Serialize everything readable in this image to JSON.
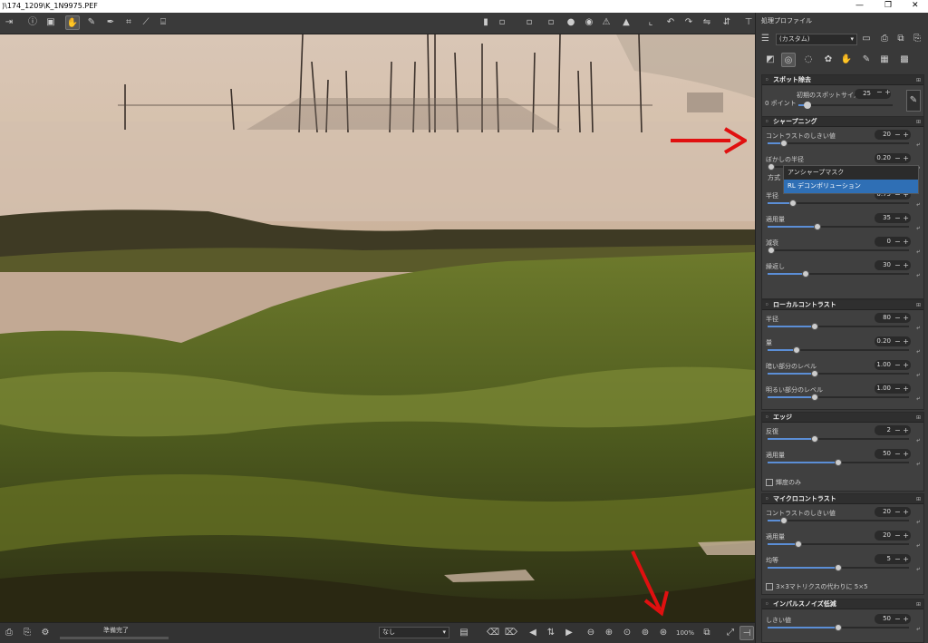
{
  "window": {
    "title": ")\\174_1209\\K_1N9975.PEF",
    "controls": [
      "—",
      "❐",
      "✕"
    ]
  },
  "right_header": {
    "title": "処理プロファイル",
    "profile": "(カスタム)"
  },
  "sections": {
    "spot": {
      "title": "スポット除去",
      "points": "0 ポイント",
      "initial_size_label": "初期のスポットサイズ",
      "initial_size_value": "25"
    },
    "sharpening": {
      "title": "シャープニング",
      "contrast_label": "コントラストのしきい値",
      "contrast_value": "20",
      "blur_label": "ぼかしの半径",
      "blur_value": "0.20",
      "method_label": "方式",
      "radius_label": "半径",
      "radius_value": "0.75",
      "amount_label": "適用量",
      "amount_value": "35",
      "damping_label": "減衰",
      "damping_value": "0",
      "iterations_label": "繰返し",
      "iterations_value": "30"
    },
    "local_contrast": {
      "title": "ローカルコントラスト",
      "radius_label": "半径",
      "radius_value": "80",
      "amount_label": "量",
      "amount_value": "0.20",
      "dark_label": "暗い部分のレベル",
      "dark_value": "1.00",
      "light_label": "明るい部分のレベル",
      "light_value": "1.00"
    },
    "edges": {
      "title": "エッジ",
      "iter_label": "反復",
      "iter_value": "2",
      "amount_label": "適用量",
      "amount_value": "50",
      "luminance_only": "輝度のみ"
    },
    "micro": {
      "title": "マイクロコントラスト",
      "contrast_label": "コントラストのしきい値",
      "contrast_value": "20",
      "amount_label": "適用量",
      "amount_value": "20",
      "uniformity_label": "均等",
      "uniformity_value": "5",
      "matrix_label": "3×3マトリクスの代わりに 5×5"
    },
    "impulse": {
      "title": "インパルスノイズ低減",
      "threshold_label": "しきい値",
      "threshold_value": "50"
    }
  },
  "dropdown": {
    "items": [
      "アンシャープマスク",
      "RL デコンボリューション"
    ],
    "selected_index": 1
  },
  "status": {
    "text": "準備完了",
    "filter": "なし",
    "zoom": "100%"
  },
  "colors": {
    "accent": "#2f6fb5",
    "arrow": "#e01010"
  }
}
